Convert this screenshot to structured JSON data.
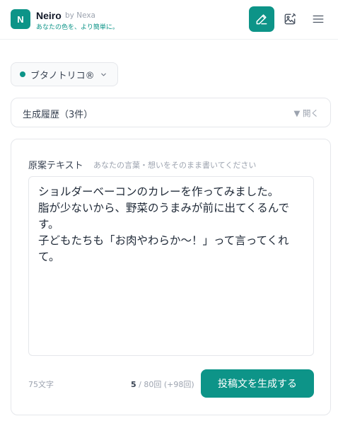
{
  "header": {
    "logo_letter": "N",
    "brand_name": "Neiro",
    "brand_by": "by Nexa",
    "tagline": "あなたの色を、より簡単に。",
    "buttons": [
      {
        "name": "compose",
        "icon": "pencil-icon",
        "active": true
      },
      {
        "name": "image",
        "icon": "image-edit-icon",
        "active": false
      },
      {
        "name": "menu",
        "icon": "hamburger-menu-icon",
        "active": false
      }
    ]
  },
  "persona": {
    "label": "ブタノトリコ®",
    "status_color": "#0d9488"
  },
  "history": {
    "title": "生成履歴（3件）",
    "toggle_label": "▼ 開く"
  },
  "editor": {
    "label": "原案テキスト",
    "hint": "あなたの言葉・想いをそのまま書いてください",
    "value": "ショルダーベーコンのカレーを作ってみました。\n脂が少ないから、野菜のうまみが前に出てくるんで\nす。\n子どもたちも「お肉やわらか〜！」って言ってくれ\nて。",
    "char_count": "75文字"
  },
  "usage": {
    "used": "5",
    "rest": " / 80回 (+98回)"
  },
  "generate_button": {
    "label": "投稿文を生成する"
  },
  "colors": {
    "accent": "#0d9488",
    "border": "#e5e7eb",
    "muted_text": "#9ca3af"
  }
}
